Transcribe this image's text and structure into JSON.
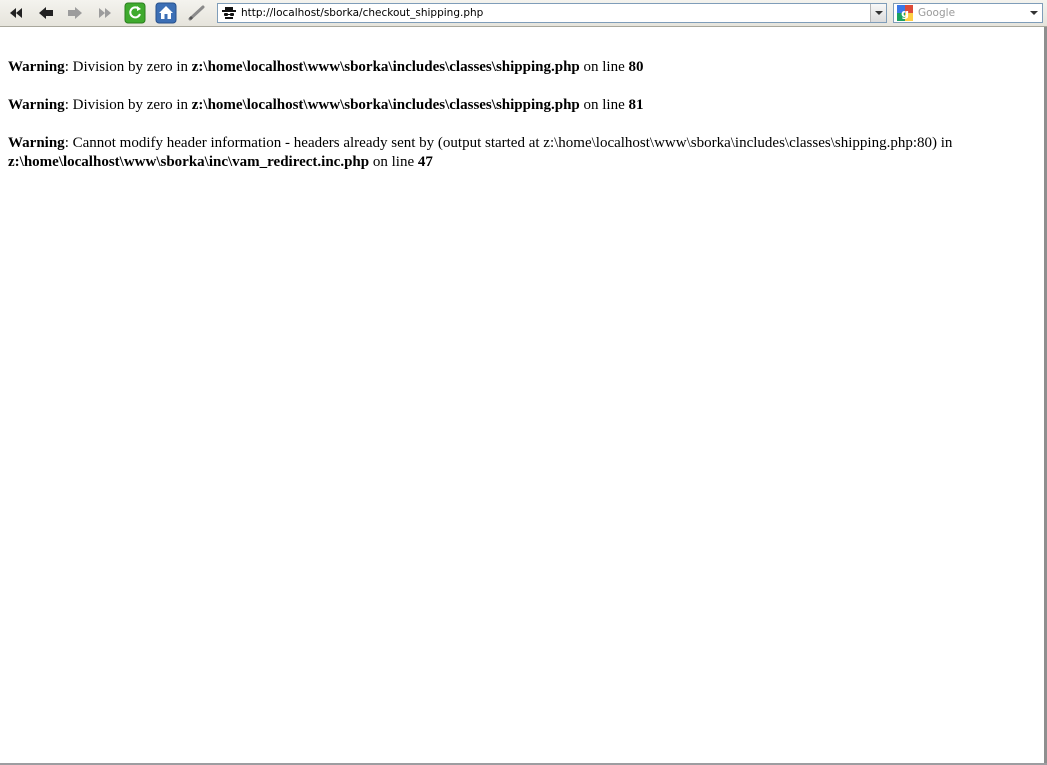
{
  "toolbar": {
    "buttons": [
      {
        "name": "rewind-icon"
      },
      {
        "name": "back-icon"
      },
      {
        "name": "forward-icon"
      },
      {
        "name": "fast-forward-icon"
      },
      {
        "name": "reload-icon"
      },
      {
        "name": "home-icon"
      },
      {
        "name": "edit-icon"
      }
    ],
    "address": {
      "url": "http://localhost/sborka/checkout_shipping.php",
      "site_icon": "spy-icon"
    },
    "search": {
      "placeholder": "Google",
      "engine_icon": "google-icon"
    }
  },
  "page": {
    "warnings": [
      {
        "label": "Warning",
        "text": ": Division by zero in ",
        "path": "z:\\home\\localhost\\www\\sborka\\includes\\classes\\shipping.php",
        "line_prefix": " on line ",
        "line": "80"
      },
      {
        "label": "Warning",
        "text": ": Division by zero in ",
        "path": "z:\\home\\localhost\\www\\sborka\\includes\\classes\\shipping.php",
        "line_prefix": " on line ",
        "line": "81"
      },
      {
        "label": "Warning",
        "text": ": Cannot modify header information - headers already sent by (output started at z:\\home\\localhost\\www\\sborka\\includes\\classes\\shipping.php:80) in ",
        "path": "z:\\home\\localhost\\www\\sborka\\inc\\vam_redirect.inc.php",
        "line_prefix": " on line ",
        "line": "47"
      }
    ]
  },
  "colors": {
    "reload_green": "#3faa2e",
    "home_blue": "#3c6fb5",
    "url_border": "#7f9db9"
  }
}
